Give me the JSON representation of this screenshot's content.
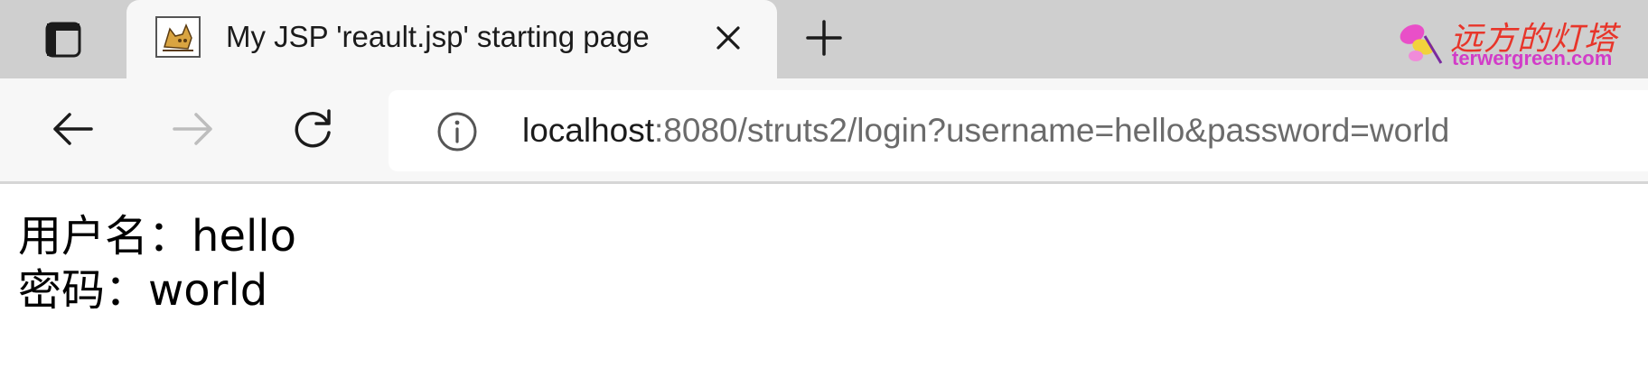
{
  "tab": {
    "title": "My JSP 'reault.jsp' starting page",
    "favicon": "tomcat-icon",
    "close_icon": "close-icon"
  },
  "tab_actions_icon": "tab-actions-icon",
  "new_tab_icon": "plus-icon",
  "watermark": {
    "name_cn": "远方的灯塔",
    "domain": "terwergreen.com"
  },
  "toolbar": {
    "back_icon": "back-arrow-icon",
    "forward_icon": "forward-arrow-icon",
    "refresh_icon": "refresh-icon",
    "info_icon": "info-icon"
  },
  "address": {
    "host": "localhost",
    "rest": ":8080/struts2/login?username=hello&password=world"
  },
  "page": {
    "username_label": "用户名：",
    "username_value": "hello",
    "password_label": "密码：",
    "password_value": "world"
  },
  "colors": {
    "tabstrip_bg": "#cfcfcf",
    "active_tab_bg": "#f7f7f7",
    "watermark_red": "#e8352a",
    "watermark_magenta": "#d23cc8"
  }
}
